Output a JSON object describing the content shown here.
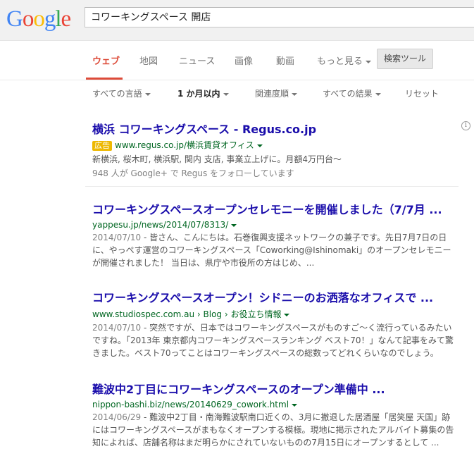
{
  "search": {
    "query": "コワーキングスペース 開店"
  },
  "tabs": [
    {
      "label": "ウェブ",
      "active": true
    },
    {
      "label": "地図"
    },
    {
      "label": "ニュース"
    },
    {
      "label": "画像"
    },
    {
      "label": "動画"
    },
    {
      "label": "もっと見る"
    }
  ],
  "tools_label": "検索ツール",
  "filters": [
    {
      "label": "すべての言語"
    },
    {
      "label": "1 か月以内"
    },
    {
      "label": "関連度順"
    },
    {
      "label": "すべての結果"
    },
    {
      "label": "リセット"
    }
  ],
  "ad": {
    "title": "横浜 コワーキングスペース - Regus.co.jp",
    "badge": "広告",
    "url": "www.regus.co.jp/横浜賃貸オフィス",
    "line2": "新横浜, 桜木町, 横浜駅, 関内 支店, 事業立上げに。月額4万円台〜",
    "line3": "948 人が Google+ で Regus をフォローしています"
  },
  "results": [
    {
      "title": "コワーキングスペースオープンセレモニーを開催しました（7/7月 ...",
      "url": "yappesu.jp/news/2014/07/8313/",
      "date": "2014/07/10",
      "snippet": " - 皆さん、こんにちは。石巻復興支援ネットワークの兼子です。先日7月7日の日に、やっぺす運営のコワーキングスペース「Coworking@Ishinomaki」のオープンセレモニーが開催されました！ 当日は、県庁や市役所の方はじめ、..."
    },
    {
      "title": "コワーキングスペースオープン！シドニーのお洒落なオフィスで ...",
      "url": "www.studiospec.com.au › Blog › お役立ち情報",
      "date": "2014/07/10",
      "snippet": " - 突然ですが、日本ではコワーキングスペースがものすご〜く流行っているみたいですね。「2013年 東京都内コワーキングスペースランキング ベスト70！」なんて記事をみて驚きました。ベスト70ってことはコワーキングスペースの総数ってどれくらいなのでしょう。"
    },
    {
      "title": "難波中2丁目にコワーキングスペースのオープン準備中 ...",
      "url": "nippon-bashi.biz/news/20140629_cowork.html",
      "date": "2014/06/29",
      "snippet": " - 難波中2丁目・南海難波駅南口近くの、3月に撤退した居酒屋「居笑屋 天国」跡にはコワーキングスペースがまもなくオープンする模様。現地に掲示されたアルバイト募集の告知によれば、店舗名称はまだ明らかにされていないものの7月15日にオープンするとして ..."
    }
  ],
  "colors": {
    "link": "#1a0dab",
    "url": "#006621",
    "active_tab": "#dd4b39",
    "ad_badge": "#edb802"
  },
  "logo_text": "Google"
}
